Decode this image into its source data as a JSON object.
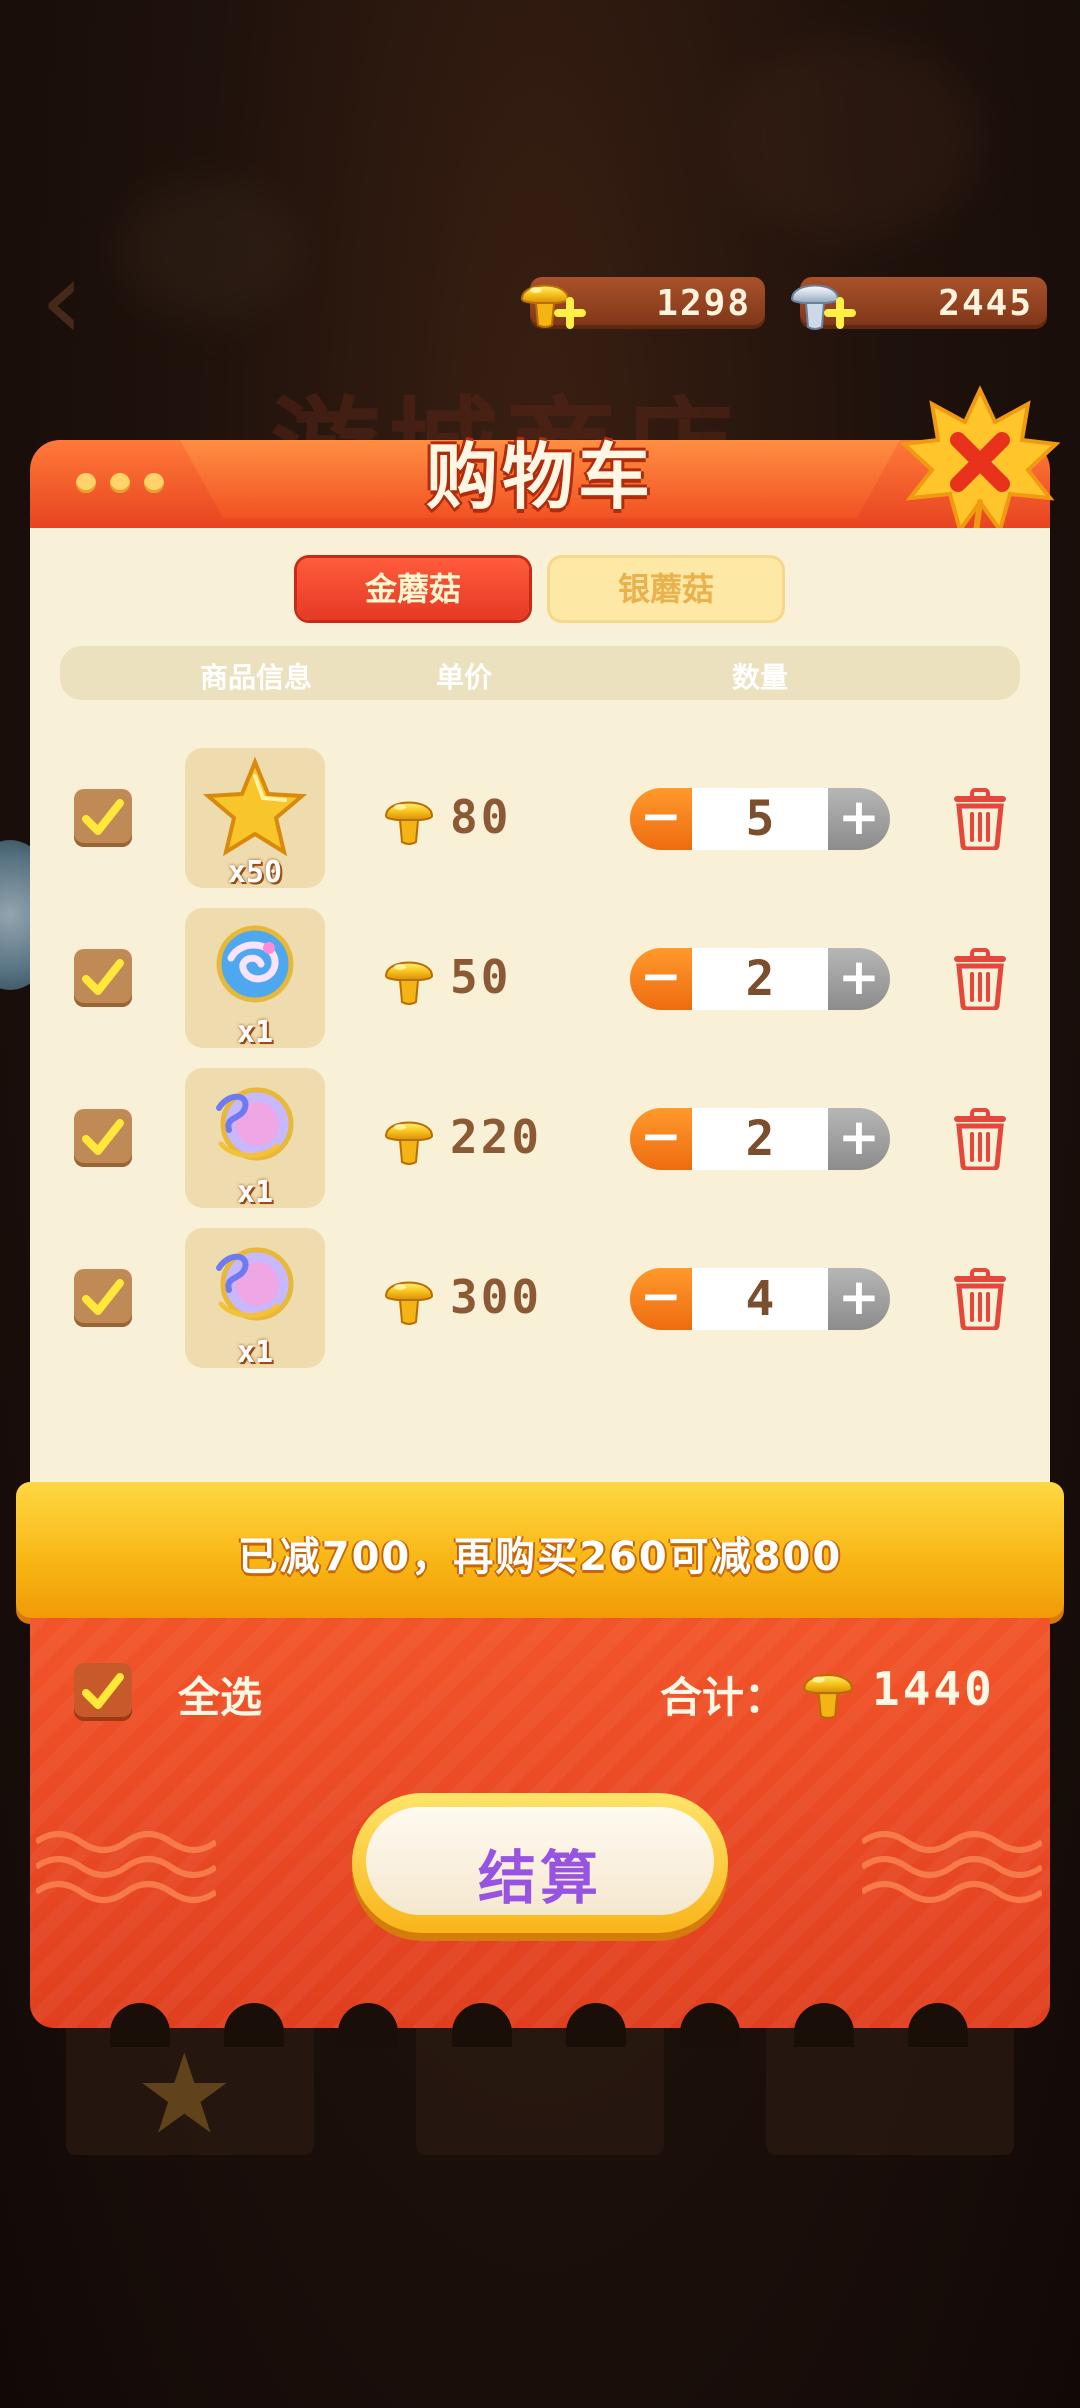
{
  "currency": {
    "gold": "1298",
    "silver": "2445"
  },
  "background_title": "游城商店",
  "cart": {
    "title": "购物车",
    "tabs": [
      {
        "label": "金蘑菇",
        "active": true
      },
      {
        "label": "银蘑菇",
        "active": false
      }
    ],
    "columns": {
      "info": "商品信息",
      "price": "单价",
      "quantity": "数量"
    },
    "items": [
      {
        "icon": "gold-star-icon",
        "count": "x50",
        "price": "80",
        "quantity": "5",
        "checked": true
      },
      {
        "icon": "swirl-orb-icon",
        "count": "x1",
        "price": "50",
        "quantity": "2",
        "checked": true
      },
      {
        "icon": "dragon-orb-icon",
        "count": "x1",
        "price": "220",
        "quantity": "2",
        "checked": true
      },
      {
        "icon": "dragon-orb-icon",
        "count": "x1",
        "price": "300",
        "quantity": "4",
        "checked": true
      }
    ],
    "promo": "已减700，再购买260可减800",
    "select_all": "全选",
    "total_label": "合计：",
    "total": "1440",
    "checkout": "结算"
  },
  "colors": {
    "accent": "#e5421f",
    "promo": "#f8b514",
    "checkout_text": "#9654e0"
  }
}
